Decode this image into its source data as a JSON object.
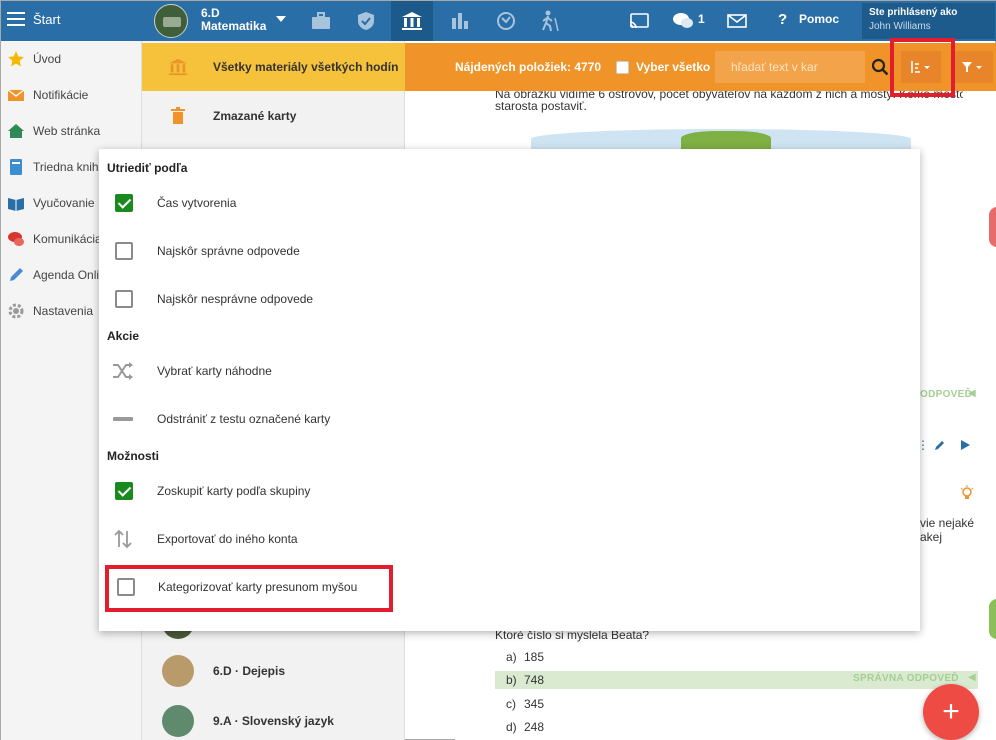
{
  "topbar": {
    "start_label": "Štart",
    "class_name_line1": "6.D",
    "class_name_line2": "Matematika",
    "chat_count": "1",
    "help_label": "Pomoc",
    "logged_in_label": "Ste prihlásený ako",
    "user_name": "John Williams",
    "nav_icons": [
      "briefcase-icon",
      "shield-icon",
      "institution-icon",
      "bar-chart-icon",
      "strategy-icon",
      "hiking-icon"
    ]
  },
  "sidebar": {
    "items": [
      {
        "label": "Úvod",
        "icon": "star-icon",
        "color": "#f5b800"
      },
      {
        "label": "Notifikácie",
        "icon": "envelope-icon",
        "color": "#f0942a"
      },
      {
        "label": "Web stránka",
        "icon": "home-icon",
        "color": "#2e8b57"
      },
      {
        "label": "Triedna kniha",
        "icon": "book-icon",
        "color": "#3b8fd1"
      },
      {
        "label": "Vyučovanie",
        "icon": "open-book-icon",
        "color": "#2a6ea7"
      },
      {
        "label": "Komunikácia",
        "icon": "chat-icon",
        "color": "#d9372d"
      },
      {
        "label": "Agenda Online",
        "icon": "pencil-icon",
        "color": "#4a8ad4"
      },
      {
        "label": "Nastavenia",
        "icon": "gear-icon",
        "color": "#9a9a9a"
      }
    ]
  },
  "materials": {
    "active_label": "Všetky materiály všetkých hodín",
    "deleted_label": "Zmazané karty",
    "subjects": [
      {
        "label": "6.D · Dejepis"
      },
      {
        "label": "9.A · Slovenský jazyk"
      }
    ]
  },
  "toolbar": {
    "found_label": "Nájdených položiek: 4770",
    "select_all_label": "Vyber všetko",
    "search_placeholder": "hľadať text v kar"
  },
  "content": {
    "text_top1": "Na obrázku vidíme 6 ostrovov, počet obyvateľov na každom z nich a mostý. Koľko mostov musí",
    "text_top2": "starosta postaviť.",
    "correct_answer_label": "SPRÁVNA ODPOVEĎ",
    "correct_answer_label_short": "ODPOVEĎ",
    "side_text1": "vie nejaké",
    "side_text2": "akej",
    "question": "Ktoré číslo si myslela Beata?",
    "answers": [
      {
        "letter": "a)",
        "value": "185"
      },
      {
        "letter": "b)",
        "value": "748"
      },
      {
        "letter": "c)",
        "value": "345"
      },
      {
        "letter": "d)",
        "value": "248"
      }
    ]
  },
  "dropdown": {
    "sort_header": "Utriediť podľa",
    "sort_options": [
      {
        "label": "Čas vytvorenia",
        "checked": true
      },
      {
        "label": "Najskôr správne odpovede",
        "checked": false
      },
      {
        "label": "Najskôr nesprávne odpovede",
        "checked": false
      }
    ],
    "actions_header": "Akcie",
    "actions": [
      {
        "label": "Vybrať karty náhodne",
        "icon": "shuffle-icon"
      },
      {
        "label": "Odstrániť z testu označené karty",
        "icon": "minus-icon"
      }
    ],
    "options_header": "Možnosti",
    "options": [
      {
        "label": "Zoskupiť karty podľa skupiny",
        "checked": true
      },
      {
        "label": "Exportovať do iného konta",
        "icon": "transfer-icon"
      },
      {
        "label": "Kategorizovať karty presunom myšou",
        "checked": false
      }
    ]
  },
  "fab": {
    "label": "+"
  },
  "colors": {
    "topbar": "#2a6ea7",
    "orange": "#f0942a",
    "yellow": "#f6c23b",
    "highlight": "#e21d2e",
    "checked": "#1a8a1f",
    "fab": "#ef4b45"
  }
}
